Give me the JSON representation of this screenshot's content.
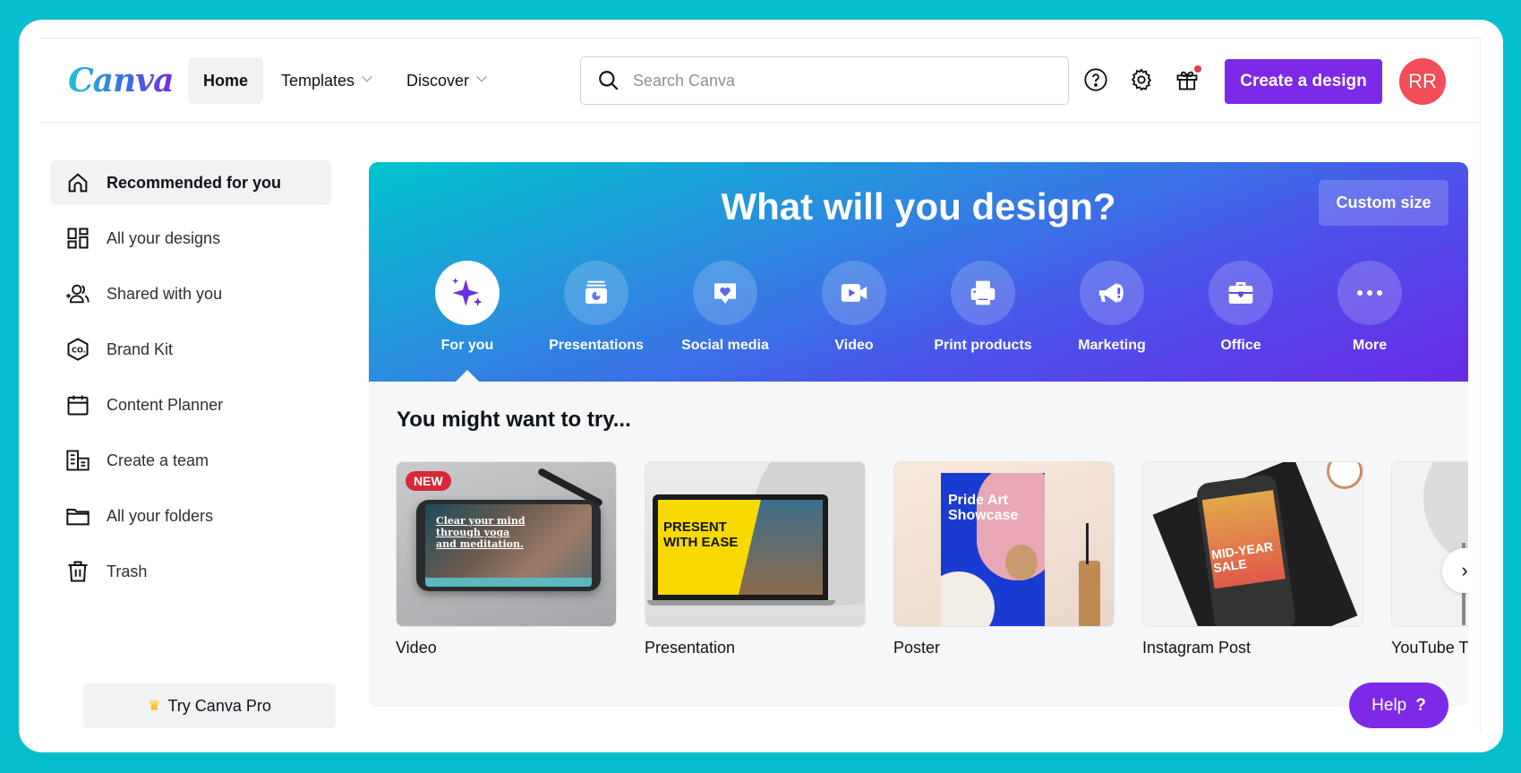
{
  "header": {
    "logo": "Canva",
    "nav": [
      {
        "label": "Home",
        "active": true
      },
      {
        "label": "Templates",
        "has_dropdown": true
      },
      {
        "label": "Discover",
        "has_dropdown": true
      }
    ],
    "search_placeholder": "Search Canva",
    "icons": [
      "help-icon",
      "settings-icon",
      "gift-icon"
    ],
    "gift_notification": true,
    "create_button": "Create a design",
    "avatar_initials": "RR"
  },
  "sidebar": {
    "items": [
      {
        "label": "Recommended for you",
        "icon": "home-icon",
        "active": true
      },
      {
        "label": "All your designs",
        "icon": "grid-icon"
      },
      {
        "label": "Shared with you",
        "icon": "shared-users-icon"
      },
      {
        "label": "Brand Kit",
        "icon": "brand-kit-icon"
      },
      {
        "label": "Content Planner",
        "icon": "calendar-icon"
      },
      {
        "label": "Create a team",
        "icon": "team-building-icon"
      },
      {
        "label": "All your folders",
        "icon": "folder-icon"
      },
      {
        "label": "Trash",
        "icon": "trash-icon"
      }
    ],
    "pro_button": "Try Canva Pro"
  },
  "hero": {
    "title": "What will you design?",
    "custom_size": "Custom size",
    "categories": [
      {
        "label": "For you",
        "icon": "sparkle-icon",
        "active": true
      },
      {
        "label": "Presentations",
        "icon": "presentation-icon"
      },
      {
        "label": "Social media",
        "icon": "heart-chat-icon"
      },
      {
        "label": "Video",
        "icon": "video-camera-icon"
      },
      {
        "label": "Print products",
        "icon": "printer-icon"
      },
      {
        "label": "Marketing",
        "icon": "megaphone-icon"
      },
      {
        "label": "Office",
        "icon": "briefcase-icon"
      },
      {
        "label": "More",
        "icon": "more-dots-icon"
      }
    ]
  },
  "suggestions": {
    "title": "You might want to try...",
    "items": [
      {
        "label": "Video",
        "badge": "NEW",
        "thumb_text": "Clear your mind through yoga and meditation."
      },
      {
        "label": "Presentation",
        "thumb_text": "PRESENT WITH EASE"
      },
      {
        "label": "Poster",
        "thumb_text": "Pride Art Showcase"
      },
      {
        "label": "Instagram Post",
        "thumb_text": "MID-YEAR SALE"
      },
      {
        "label": "YouTube Thumbnail"
      }
    ]
  },
  "help_button": "Help",
  "help_glyph": "?",
  "colors": {
    "background": "#06BECE",
    "primary": "#7D2AE8",
    "avatar": "#F24D58",
    "badge_new": "#D6293B"
  }
}
